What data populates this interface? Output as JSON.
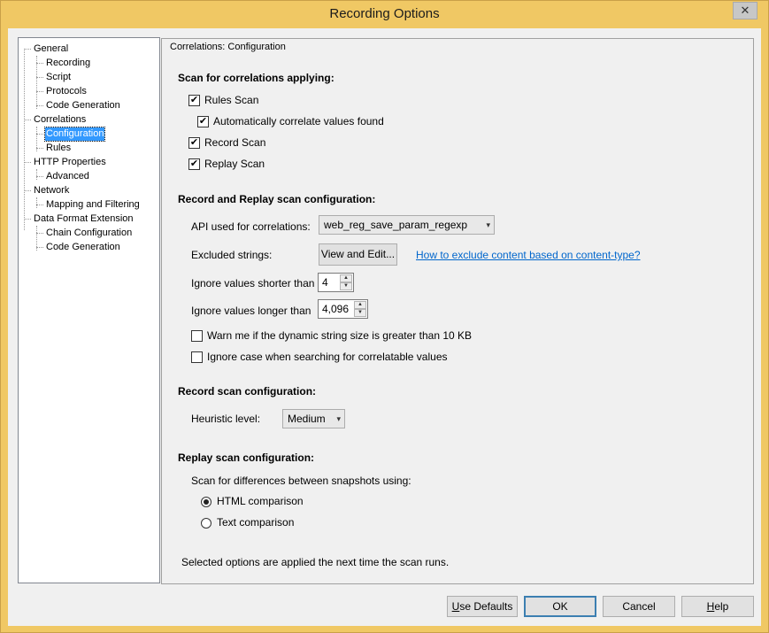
{
  "window": {
    "title": "Recording Options",
    "close_label": "✕"
  },
  "tree": {
    "items": [
      {
        "label": "General",
        "level": 0
      },
      {
        "label": "Recording",
        "level": 1
      },
      {
        "label": "Script",
        "level": 1
      },
      {
        "label": "Protocols",
        "level": 1
      },
      {
        "label": "Code Generation",
        "level": 1
      },
      {
        "label": "Correlations",
        "level": 0
      },
      {
        "label": "Configuration",
        "level": 1,
        "selected": true
      },
      {
        "label": "Rules",
        "level": 1
      },
      {
        "label": "HTTP Properties",
        "level": 0
      },
      {
        "label": "Advanced",
        "level": 1
      },
      {
        "label": "Network",
        "level": 0
      },
      {
        "label": "Mapping and Filtering",
        "level": 1
      },
      {
        "label": "Data Format Extension",
        "level": 0
      },
      {
        "label": "Chain Configuration",
        "level": 1
      },
      {
        "label": "Code Generation",
        "level": 1
      }
    ]
  },
  "panel": {
    "group_title": "Correlations: Configuration",
    "scan_section": "Scan for correlations applying:",
    "rules_scan": {
      "label": "Rules Scan",
      "checked": true
    },
    "auto_correlate": {
      "label": "Automatically correlate values found",
      "checked": true
    },
    "record_scan": {
      "label": "Record Scan",
      "checked": true
    },
    "replay_scan": {
      "label": "Replay Scan",
      "checked": true
    },
    "rr_section": "Record and Replay scan configuration:",
    "api_label": "API used for correlations:",
    "api_value": "web_reg_save_param_regexp",
    "excluded_label": "Excluded strings:",
    "view_edit_button": "View and Edit...",
    "exclude_link": "How to exclude content based on content-type?",
    "shorter_label": "Ignore values shorter than",
    "shorter_value": "4",
    "longer_label": "Ignore values longer than",
    "longer_value": "4,096",
    "warn": {
      "label": "Warn me if the dynamic string size is greater than 10 KB",
      "checked": false
    },
    "ignore_case": {
      "label": "Ignore case when searching for correlatable values",
      "checked": false
    },
    "record_section": "Record scan configuration:",
    "heuristic_label": "Heuristic level:",
    "heuristic_value": "Medium",
    "replay_section": "Replay scan configuration:",
    "diff_label": "Scan for differences between snapshots using:",
    "html_comparison": {
      "label": "HTML comparison",
      "selected": true
    },
    "text_comparison": {
      "label": "Text comparison",
      "selected": false
    },
    "footer_note": "Selected options are applied the next time the scan runs."
  },
  "buttons": {
    "use_defaults_mnemonic": "U",
    "use_defaults_rest": "se Defaults",
    "ok": "OK",
    "cancel": "Cancel",
    "help_mnemonic": "H",
    "help_rest": "elp"
  }
}
